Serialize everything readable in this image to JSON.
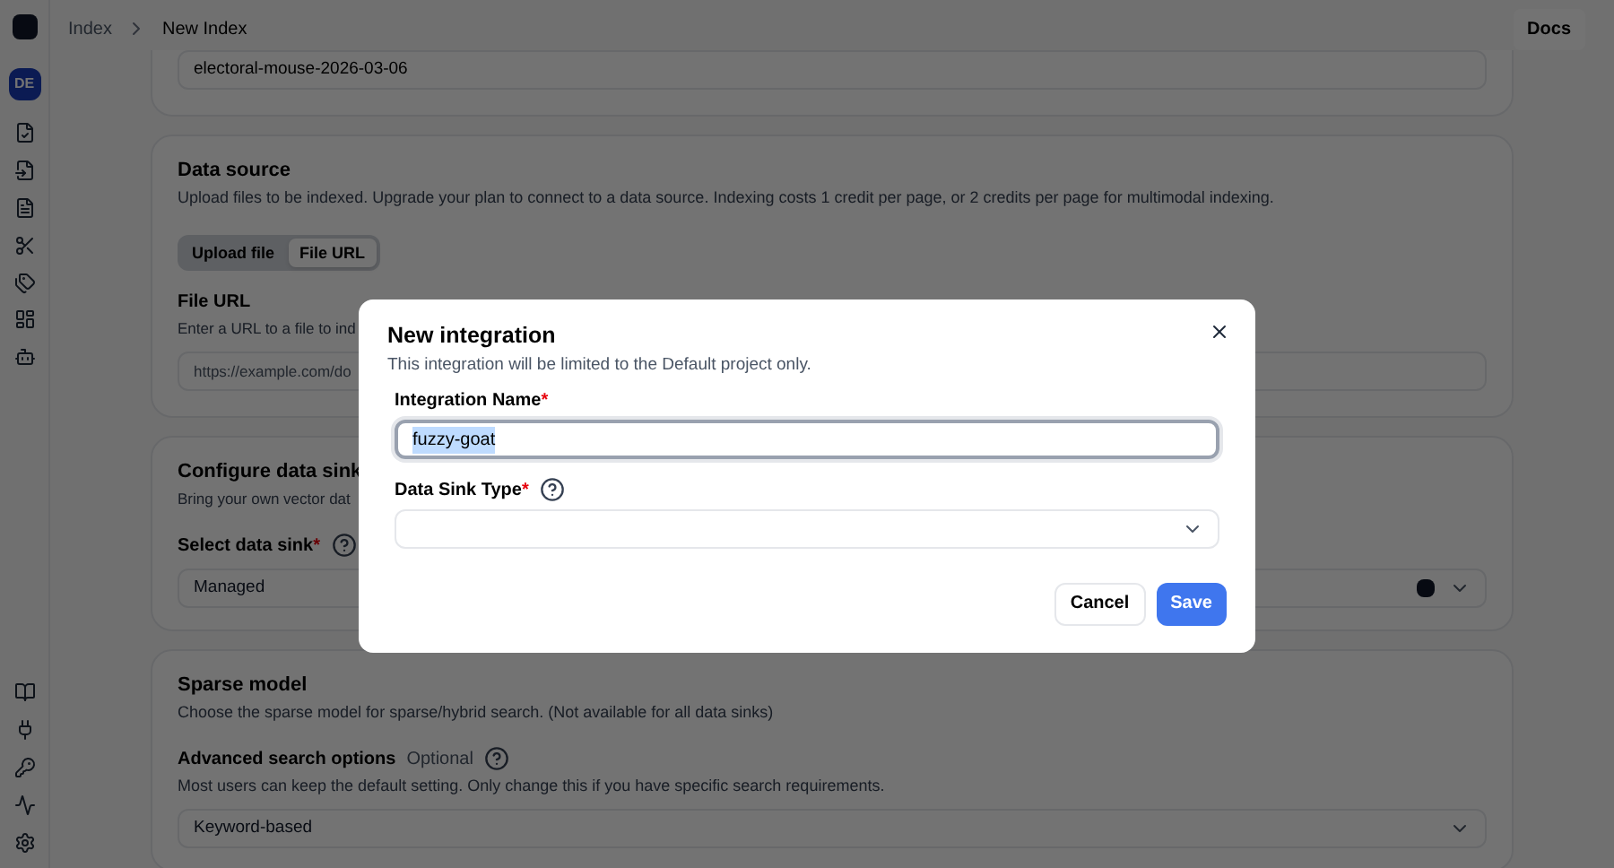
{
  "breadcrumb": [
    {
      "label": "Index",
      "current": false
    },
    {
      "label": "New Index",
      "current": true
    }
  ],
  "docs_button": "Docs",
  "sidebar": {
    "avatar": "DE"
  },
  "name_card": {
    "value": "electoral-mouse-2026-03-06"
  },
  "data_source": {
    "title": "Data source",
    "description": "Upload files to be indexed. Upgrade your plan to connect to a data source. Indexing costs 1 credit per page, or 2 credits per page for multimodal indexing.",
    "tabs": [
      {
        "label": "Upload file",
        "selected": false
      },
      {
        "label": "File URL",
        "selected": true
      }
    ],
    "file_url": {
      "label": "File URL",
      "description": "Enter a URL to a file to ind",
      "placeholder": "https://example.com/do"
    }
  },
  "data_sink": {
    "title": "Configure data sink",
    "description": "Bring your own vector dat",
    "select_label": "Select data sink",
    "required_mark": "*",
    "value": "Managed"
  },
  "sparse_model": {
    "title": "Sparse model",
    "description": "Choose the sparse model for sparse/hybrid search. (Not available for all data sinks)",
    "advanced_label": "Advanced search options",
    "optional_tag": "Optional",
    "advanced_description": "Most users can keep the default setting. Only change this if you have specific search requirements.",
    "value": "Keyword-based"
  },
  "dialog": {
    "title": "New integration",
    "subtitle": "This integration will be limited to the Default project only.",
    "fields": [
      {
        "kind": "text",
        "label": "Integration Name",
        "required_mark": "*",
        "value": "fuzzy-goat",
        "focused": true,
        "help": false
      },
      {
        "kind": "select",
        "label": "Data Sink Type",
        "required_mark": "*",
        "focused": false,
        "help": true
      }
    ],
    "buttons": [
      {
        "kind": "secondary",
        "label": "Cancel"
      },
      {
        "kind": "primary",
        "label": "Save"
      }
    ]
  }
}
